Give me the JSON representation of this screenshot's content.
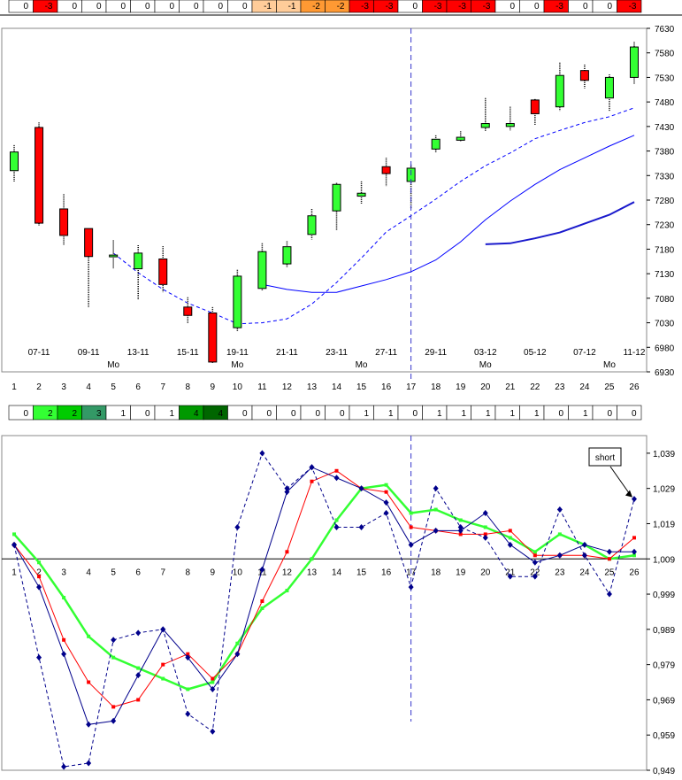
{
  "colors": {
    "cell_red": "#ff0000",
    "cell_orange": "#ff9933",
    "cell_peach": "#ffcc99",
    "cell_lime": "#33ff33",
    "cell_green": "#00cc00",
    "cell_teal": "#339966",
    "cell_darkgreen": "#006600",
    "cell_midgreen": "#009900",
    "up_candle": "#33ff33",
    "down_candle": "#ff0000",
    "ma_blue": "#0000ff",
    "ma_dark": "#1a1acc",
    "ind_green": "#33ff33",
    "ind_red": "#ff0000",
    "ind_blue": "#00008b"
  },
  "top_strip": [
    {
      "v": "0",
      "c": ""
    },
    {
      "v": "-3",
      "c": "cell_red"
    },
    {
      "v": "0",
      "c": ""
    },
    {
      "v": "0",
      "c": ""
    },
    {
      "v": "0",
      "c": ""
    },
    {
      "v": "0",
      "c": ""
    },
    {
      "v": "0",
      "c": ""
    },
    {
      "v": "0",
      "c": ""
    },
    {
      "v": "0",
      "c": ""
    },
    {
      "v": "0",
      "c": ""
    },
    {
      "v": "-1",
      "c": "cell_peach"
    },
    {
      "v": "-1",
      "c": "cell_peach"
    },
    {
      "v": "-2",
      "c": "cell_orange"
    },
    {
      "v": "-2",
      "c": "cell_orange"
    },
    {
      "v": "-3",
      "c": "cell_red"
    },
    {
      "v": "-3",
      "c": "cell_red"
    },
    {
      "v": "0",
      "c": ""
    },
    {
      "v": "-3",
      "c": "cell_red"
    },
    {
      "v": "-3",
      "c": "cell_red"
    },
    {
      "v": "-3",
      "c": "cell_red"
    },
    {
      "v": "0",
      "c": ""
    },
    {
      "v": "0",
      "c": ""
    },
    {
      "v": "-3",
      "c": "cell_red"
    },
    {
      "v": "0",
      "c": ""
    },
    {
      "v": "0",
      "c": ""
    },
    {
      "v": "-3",
      "c": "cell_red"
    }
  ],
  "mid_strip": [
    {
      "v": "0",
      "c": ""
    },
    {
      "v": "2",
      "c": "cell_lime"
    },
    {
      "v": "2",
      "c": "cell_green"
    },
    {
      "v": "3",
      "c": "cell_teal"
    },
    {
      "v": "1",
      "c": ""
    },
    {
      "v": "0",
      "c": ""
    },
    {
      "v": "1",
      "c": ""
    },
    {
      "v": "4",
      "c": "cell_midgreen"
    },
    {
      "v": "4",
      "c": "cell_darkgreen"
    },
    {
      "v": "0",
      "c": ""
    },
    {
      "v": "0",
      "c": ""
    },
    {
      "v": "0",
      "c": ""
    },
    {
      "v": "0",
      "c": ""
    },
    {
      "v": "0",
      "c": ""
    },
    {
      "v": "1",
      "c": ""
    },
    {
      "v": "1",
      "c": ""
    },
    {
      "v": "0",
      "c": ""
    },
    {
      "v": "1",
      "c": ""
    },
    {
      "v": "1",
      "c": ""
    },
    {
      "v": "1",
      "c": ""
    },
    {
      "v": "1",
      "c": ""
    },
    {
      "v": "1",
      "c": ""
    },
    {
      "v": "0",
      "c": ""
    },
    {
      "v": "1",
      "c": ""
    },
    {
      "v": "0",
      "c": ""
    },
    {
      "v": "0",
      "c": ""
    }
  ],
  "index_labels": [
    "1",
    "2",
    "3",
    "4",
    "5",
    "6",
    "7",
    "8",
    "9",
    "10",
    "11",
    "12",
    "13",
    "14",
    "15",
    "16",
    "17",
    "18",
    "19",
    "20",
    "21",
    "22",
    "23",
    "24",
    "25",
    "26"
  ],
  "chart_data": [
    {
      "type": "candlestick",
      "ylim": [
        6930,
        7630
      ],
      "yticks": [
        "7630",
        "7580",
        "7530",
        "7480",
        "7430",
        "7380",
        "7330",
        "7280",
        "7230",
        "7180",
        "7130",
        "7080",
        "7030",
        "6980",
        "6930"
      ],
      "date_labels": [
        {
          "x": 2,
          "text": "07-11"
        },
        {
          "x": 4,
          "text": "09-11"
        },
        {
          "x": 6,
          "text": "13-11"
        },
        {
          "x": 8,
          "text": "15-11"
        },
        {
          "x": 10,
          "text": "19-11"
        },
        {
          "x": 12,
          "text": "21-11"
        },
        {
          "x": 14,
          "text": "23-11"
        },
        {
          "x": 16,
          "text": "27-11"
        },
        {
          "x": 18,
          "text": "29-11"
        },
        {
          "x": 20,
          "text": "03-12"
        },
        {
          "x": 22,
          "text": "05-12"
        },
        {
          "x": 24,
          "text": "07-12"
        },
        {
          "x": 26,
          "text": "11-12"
        }
      ],
      "weekday_labels": [
        {
          "x": 5,
          "text": "Mo"
        },
        {
          "x": 10,
          "text": "Mo"
        },
        {
          "x": 15,
          "text": "Mo"
        },
        {
          "x": 20,
          "text": "Mo"
        },
        {
          "x": 25,
          "text": "Mo"
        }
      ],
      "marker_x": 17,
      "candles": [
        {
          "x": 1,
          "o": 7340,
          "h": 7392,
          "l": 7318,
          "c": 7378
        },
        {
          "x": 2,
          "o": 7428,
          "h": 7438,
          "l": 7228,
          "c": 7233
        },
        {
          "x": 3,
          "o": 7262,
          "h": 7292,
          "l": 7188,
          "c": 7208
        },
        {
          "x": 4,
          "o": 7222,
          "h": 7222,
          "l": 7062,
          "c": 7165
        },
        {
          "x": 5,
          "o": 7165,
          "h": 7198,
          "l": 7140,
          "c": 7168
        },
        {
          "x": 6,
          "o": 7140,
          "h": 7188,
          "l": 7078,
          "c": 7172
        },
        {
          "x": 7,
          "o": 7160,
          "h": 7186,
          "l": 7092,
          "c": 7108
        },
        {
          "x": 8,
          "o": 7062,
          "h": 7082,
          "l": 7028,
          "c": 7045
        },
        {
          "x": 9,
          "o": 7050,
          "h": 7062,
          "l": 6948,
          "c": 6950
        },
        {
          "x": 10,
          "o": 7020,
          "h": 7138,
          "l": 7012,
          "c": 7125
        },
        {
          "x": 11,
          "o": 7100,
          "h": 7192,
          "l": 7095,
          "c": 7175
        },
        {
          "x": 12,
          "o": 7150,
          "h": 7196,
          "l": 7142,
          "c": 7185
        },
        {
          "x": 13,
          "o": 7210,
          "h": 7262,
          "l": 7200,
          "c": 7248
        },
        {
          "x": 14,
          "o": 7258,
          "h": 7315,
          "l": 7218,
          "c": 7312
        },
        {
          "x": 15,
          "o": 7288,
          "h": 7318,
          "l": 7272,
          "c": 7294
        },
        {
          "x": 16,
          "o": 7348,
          "h": 7366,
          "l": 7308,
          "c": 7334
        },
        {
          "x": 17,
          "o": 7318,
          "h": 7352,
          "l": 7262,
          "c": 7345
        },
        {
          "x": 18,
          "o": 7384,
          "h": 7412,
          "l": 7376,
          "c": 7404
        },
        {
          "x": 19,
          "o": 7402,
          "h": 7420,
          "l": 7400,
          "c": 7408
        },
        {
          "x": 20,
          "o": 7428,
          "h": 7488,
          "l": 7420,
          "c": 7436
        },
        {
          "x": 21,
          "o": 7430,
          "h": 7470,
          "l": 7422,
          "c": 7436
        },
        {
          "x": 22,
          "o": 7484,
          "h": 7486,
          "l": 7432,
          "c": 7456
        },
        {
          "x": 23,
          "o": 7470,
          "h": 7560,
          "l": 7462,
          "c": 7534
        },
        {
          "x": 24,
          "o": 7544,
          "h": 7556,
          "l": 7508,
          "c": 7524
        },
        {
          "x": 25,
          "o": 7488,
          "h": 7536,
          "l": 7462,
          "c": 7530
        },
        {
          "x": 26,
          "o": 7530,
          "h": 7602,
          "l": 7516,
          "c": 7592
        }
      ],
      "series": [
        {
          "style": "dashed",
          "color": "ma_blue",
          "width": 1,
          "points": [
            [
              5,
              7172
            ],
            [
              6,
              7132
            ],
            [
              7,
              7098
            ],
            [
              8,
              7070
            ],
            [
              9,
              7050
            ],
            [
              10,
              7028
            ],
            [
              11,
              7030
            ],
            [
              12,
              7038
            ],
            [
              13,
              7068
            ],
            [
              14,
              7112
            ],
            [
              15,
              7162
            ],
            [
              16,
              7215
            ],
            [
              17,
              7248
            ],
            [
              18,
              7282
            ],
            [
              19,
              7318
            ],
            [
              20,
              7350
            ],
            [
              21,
              7376
            ],
            [
              22,
              7405
            ],
            [
              23,
              7422
            ],
            [
              24,
              7438
            ],
            [
              25,
              7450
            ],
            [
              26,
              7468
            ]
          ]
        },
        {
          "style": "solid",
          "color": "ma_blue",
          "width": 1,
          "points": [
            [
              11,
              7108
            ],
            [
              12,
              7098
            ],
            [
              13,
              7092
            ],
            [
              14,
              7092
            ],
            [
              15,
              7105
            ],
            [
              16,
              7118
            ],
            [
              17,
              7134
            ],
            [
              18,
              7158
            ],
            [
              19,
              7195
            ],
            [
              20,
              7240
            ],
            [
              21,
              7278
            ],
            [
              22,
              7312
            ],
            [
              23,
              7342
            ],
            [
              24,
              7366
            ],
            [
              25,
              7390
            ],
            [
              26,
              7412
            ]
          ]
        },
        {
          "style": "solid",
          "color": "ma_dark",
          "width": 2,
          "points": [
            [
              20,
              7190
            ],
            [
              21,
              7192
            ],
            [
              22,
              7202
            ],
            [
              23,
              7214
            ],
            [
              24,
              7232
            ],
            [
              25,
              7250
            ],
            [
              26,
              7276
            ]
          ]
        }
      ]
    },
    {
      "type": "line",
      "ylim": [
        0.949,
        1.044
      ],
      "yticks": [
        "1,039",
        "1,029",
        "1,019",
        "1,009",
        "0,999",
        "0,989",
        "0,979",
        "0,969",
        "0,959",
        "0,949"
      ],
      "baseline": 1.009,
      "marker_x": 17,
      "annotation": {
        "text": "short",
        "x": 26,
        "y": 1.026
      },
      "series": [
        {
          "color": "ind_green",
          "width": 2.5,
          "dash": false,
          "marker": "square",
          "values": [
            1.016,
            1.008,
            0.998,
            0.987,
            0.981,
            0.978,
            0.975,
            0.972,
            0.974,
            0.985,
            0.995,
            1.0,
            1.009,
            1.02,
            1.029,
            1.03,
            1.022,
            1.023,
            1.02,
            1.018,
            1.015,
            1.011,
            1.016,
            1.013,
            1.009,
            1.01
          ]
        },
        {
          "color": "ind_red",
          "width": 1,
          "dash": false,
          "marker": "square",
          "values": [
            1.013,
            1.004,
            0.986,
            0.974,
            0.967,
            0.969,
            0.979,
            0.982,
            0.975,
            0.982,
            0.997,
            1.011,
            1.031,
            1.034,
            1.029,
            1.028,
            1.018,
            1.017,
            1.016,
            1.016,
            1.017,
            1.01,
            1.01,
            1.01,
            1.009,
            1.015
          ]
        },
        {
          "color": "ind_blue",
          "width": 1,
          "dash": false,
          "marker": "diamond",
          "values": [
            1.013,
            1.001,
            0.982,
            0.962,
            0.963,
            0.976,
            0.989,
            0.981,
            0.972,
            0.982,
            1.006,
            1.028,
            1.035,
            1.032,
            1.029,
            1.025,
            1.013,
            1.017,
            1.017,
            1.022,
            1.013,
            1.008,
            1.01,
            1.013,
            1.011,
            1.011
          ]
        },
        {
          "color": "ind_blue",
          "width": 1,
          "dash": true,
          "marker": "diamond",
          "values": [
            1.013,
            0.981,
            0.95,
            0.951,
            0.986,
            0.988,
            0.989,
            0.965,
            0.96,
            1.018,
            1.039,
            1.029,
            1.035,
            1.018,
            1.018,
            1.022,
            1.001,
            1.029,
            1.018,
            1.015,
            1.004,
            1.004,
            1.023,
            1.01,
            0.999,
            1.026
          ]
        }
      ]
    }
  ]
}
